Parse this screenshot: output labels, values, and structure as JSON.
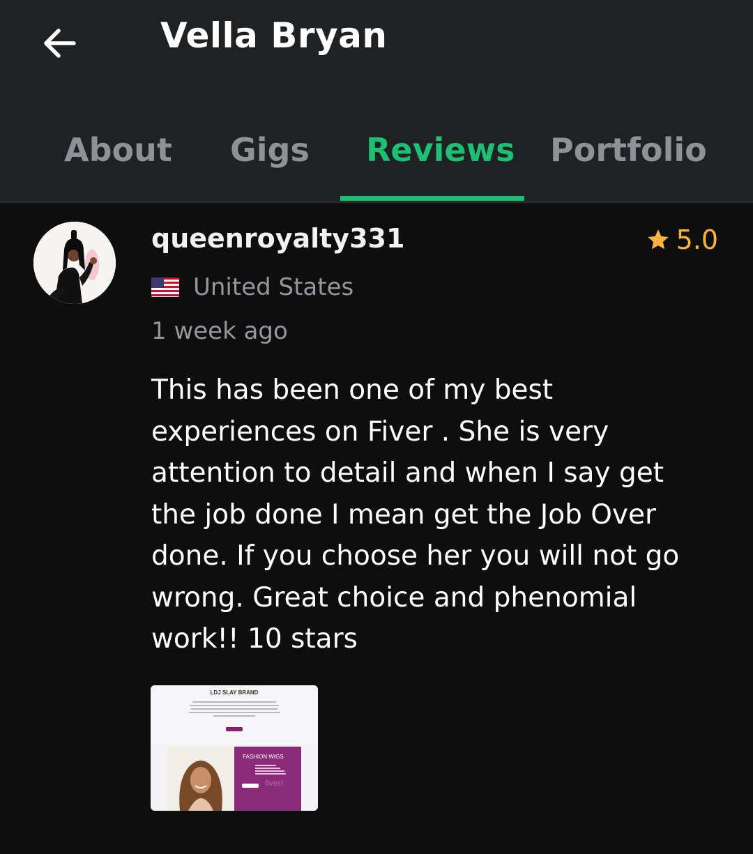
{
  "header": {
    "back_icon": "arrow-left-icon",
    "title": "Vella Bryan"
  },
  "tabs": [
    {
      "label": "About",
      "active": false
    },
    {
      "label": "Gigs",
      "active": false
    },
    {
      "label": "Reviews",
      "active": true
    },
    {
      "label": "Portfolio",
      "active": false
    }
  ],
  "review": {
    "username": "queenroyalty331",
    "rating": "5.0",
    "rating_icon": "star-icon",
    "country": "United States",
    "country_flag_icon": "us-flag-icon",
    "time_ago": "1 week ago",
    "text": "This has been one of my best experiences on Fiver . She is very attention to detail and when I say get the job done I mean get the Job Over done. If you choose her you will not go wrong. Great choice and phenomial work!! 10 stars",
    "attachment": {
      "brand": "LDJ SLAY BRAND",
      "panel_title": "FASHION WIGS",
      "watermark": "fiverr."
    }
  },
  "colors": {
    "accent": "#1dbf73",
    "star": "#ffb33e",
    "header_bg": "#202123",
    "body_bg": "#0e0e0e",
    "muted_text": "#95979d"
  }
}
